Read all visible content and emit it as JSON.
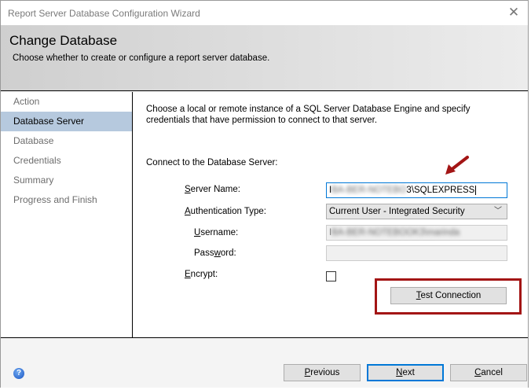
{
  "window": {
    "title": "Report Server Database Configuration Wizard",
    "close_glyph": "✕"
  },
  "header": {
    "title": "Change Database",
    "subtitle": "Choose whether to create or configure a report server database."
  },
  "sidebar": {
    "items": [
      {
        "label": "Action"
      },
      {
        "label": "Database Server"
      },
      {
        "label": "Database"
      },
      {
        "label": "Credentials"
      },
      {
        "label": "Summary"
      },
      {
        "label": "Progress and Finish"
      }
    ]
  },
  "main": {
    "intro": "Choose a local or remote instance of a SQL Server Database Engine and specify credentials that have permission to connect to that server.",
    "section": "Connect to the Database Server:",
    "server_name": {
      "label_u": "S",
      "label_rest": "erver Name:",
      "value_prefix": "I",
      "value_blurred": "BA-BER-NOTEBO",
      "value_suffix": "3\\SQLEXPRESS"
    },
    "auth": {
      "label_u": "A",
      "label_rest": "uthentication Type:",
      "value": "Current User - Integrated Security"
    },
    "username": {
      "label_u": "U",
      "label_rest": "sername:",
      "value_prefix": "I",
      "value_blurred": "BA-BER-NOTEBOOK3\\marinda"
    },
    "password": {
      "label_pre": "Pass",
      "label_u": "w",
      "label_rest": "ord:",
      "value": ""
    },
    "encrypt": {
      "label_u": "E",
      "label_rest": "ncrypt:",
      "checked": false
    },
    "test_button": {
      "label_u": "T",
      "label_rest": "est Connection"
    }
  },
  "footer": {
    "help_glyph": "?",
    "previous": {
      "label_u": "P",
      "label_rest": "revious"
    },
    "next": {
      "label_u": "N",
      "label_rest": "ext"
    },
    "cancel": {
      "label_u": "C",
      "label_rest": "ancel"
    }
  },
  "annotation_color": "#a31515"
}
